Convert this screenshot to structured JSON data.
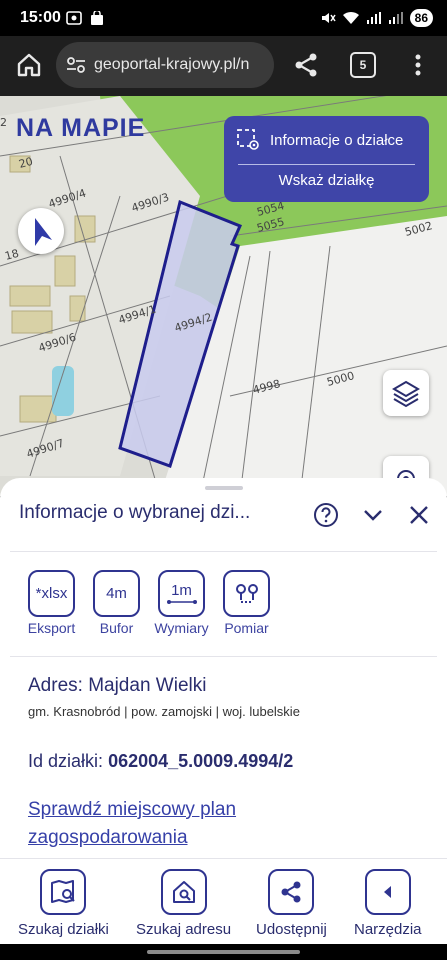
{
  "status_bar": {
    "time": "15:00",
    "battery": "86"
  },
  "browser": {
    "url": "geoportal-krajowy.pl/n",
    "tab_count": "5"
  },
  "map": {
    "logo": "NA MAPIE",
    "parcel_labels": [
      "20",
      "4990/4",
      "4990/3",
      "5054",
      "5055",
      "5002",
      "18",
      "4994/1",
      "4994/2",
      "4990/6",
      "4998",
      "5000",
      "4990/7",
      "2"
    ],
    "info_box": {
      "title": "Informacje o działce",
      "action": "Wskaż działkę"
    }
  },
  "sheet": {
    "title": "Informacje o wybranej dzi...",
    "tools": [
      {
        "icon_text": "*xlsx",
        "label": "Eksport"
      },
      {
        "icon_text": "4m",
        "label": "Bufor"
      },
      {
        "icon_text": "1m",
        "label": "Wymiary"
      },
      {
        "icon_text": "",
        "label": "Pomiar"
      }
    ],
    "address": "Adres: Majdan Wielki",
    "address_sub": "gm. Krasnobród | pow. zamojski | woj. lubelskie",
    "parcel_id_label": "Id działki:",
    "parcel_id_value": "062004_5.0009.4994/2",
    "plan_link": "Sprawdź miejscowy plan zagospodarowania"
  },
  "bottom_nav": [
    {
      "label": "Szukaj działki",
      "icon": "map-search-icon"
    },
    {
      "label": "Szukaj adresu",
      "icon": "home-search-icon"
    },
    {
      "label": "Udostępnij",
      "icon": "share-icon"
    },
    {
      "label": "Narzędzia",
      "icon": "chevron-left-icon"
    }
  ],
  "colors": {
    "brand": "#2f3490",
    "info_box": "#3f45a8",
    "parcel_fill": "#c9cbef",
    "parcel_stroke": "#1e1e8c",
    "forest": "#8cc85a"
  }
}
